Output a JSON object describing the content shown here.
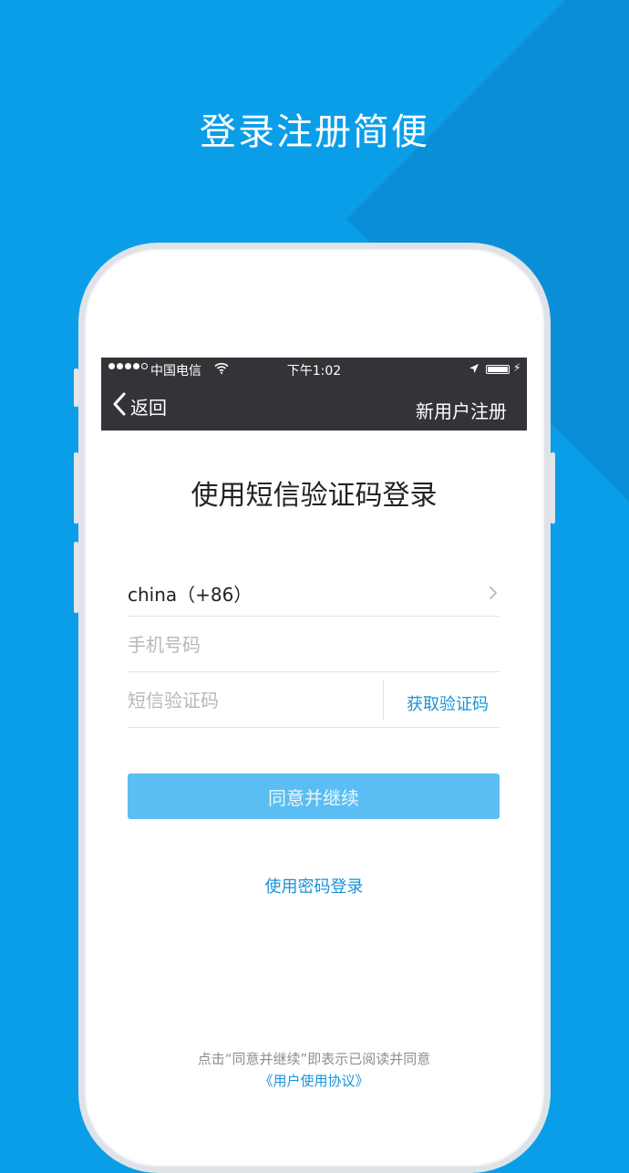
{
  "headline": "登录注册简便",
  "status_bar": {
    "carrier": "中国电信",
    "time": "下午1:02",
    "charge": "⚡"
  },
  "nav": {
    "back_label": "返回",
    "register_label": "新用户注册"
  },
  "form": {
    "title": "使用短信验证码登录",
    "country_label": "china（+86）",
    "phone_placeholder": "手机号码",
    "code_placeholder": "短信验证码",
    "get_code_label": "获取验证码",
    "submit_label": "同意并继续",
    "password_login_label": "使用密码登录"
  },
  "footer": {
    "agree_text": "点击“同意并继续”即表示已阅读并同意",
    "agreement_link": "《用户使用协议》"
  },
  "colors": {
    "background": "#0b9ee8",
    "accent": "#1a92d8",
    "button": "#5bbef2",
    "bar": "#333438"
  }
}
